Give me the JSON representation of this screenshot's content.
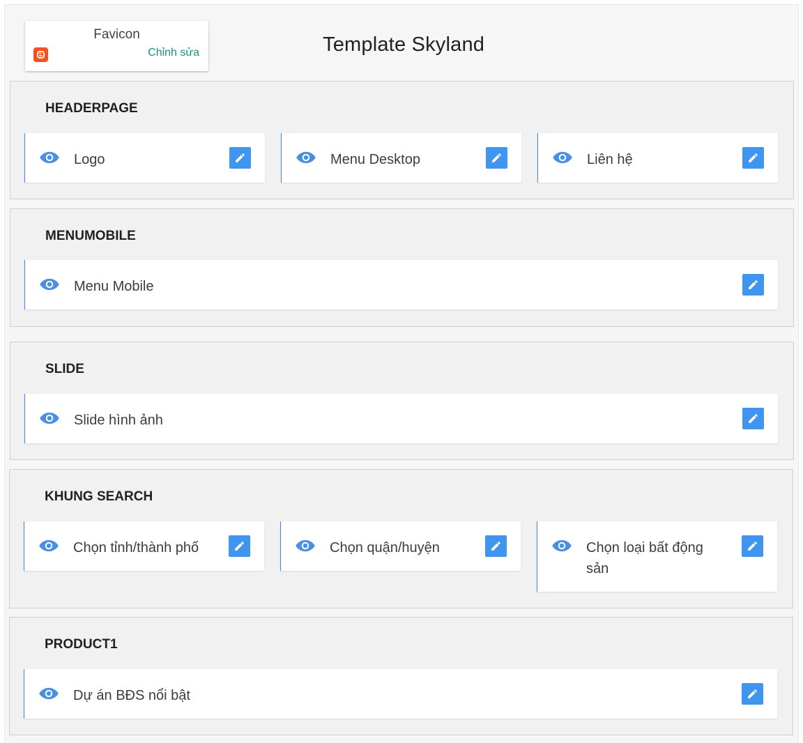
{
  "page_title": "Template Skyland",
  "favicon": {
    "title": "Favicon",
    "edit_label": "Chỉnh sửa"
  },
  "colors": {
    "accent": "#4096ee",
    "eye": "#4a90e2",
    "edit_link": "#1e8e7e",
    "blogger": "#f4511e"
  },
  "sections": [
    {
      "title": "HEADERPAGE",
      "widgets": [
        {
          "label": "Logo",
          "icon": "eye-icon"
        },
        {
          "label": "Menu Desktop",
          "icon": "eye-icon"
        },
        {
          "label": "Liên hệ",
          "icon": "eye-icon"
        }
      ]
    },
    {
      "title": "MENUMOBILE",
      "widgets": [
        {
          "label": "Menu Mobile",
          "icon": "eye-icon"
        }
      ]
    },
    {
      "title": "SLIDE",
      "widgets": [
        {
          "label": "Slide hình ảnh",
          "icon": "eye-icon"
        }
      ]
    },
    {
      "title": "KHUNG SEARCH",
      "widgets": [
        {
          "label": "Chọn tỉnh/thành phố",
          "icon": "eye-icon"
        },
        {
          "label": "Chọn quận/huyện",
          "icon": "eye-icon"
        },
        {
          "label": "Chọn loại bất động sản",
          "icon": "eye-icon"
        }
      ]
    },
    {
      "title": "PRODUCT1",
      "widgets": [
        {
          "label": "Dự án BĐS nổi bật",
          "icon": "eye-icon"
        }
      ]
    }
  ]
}
